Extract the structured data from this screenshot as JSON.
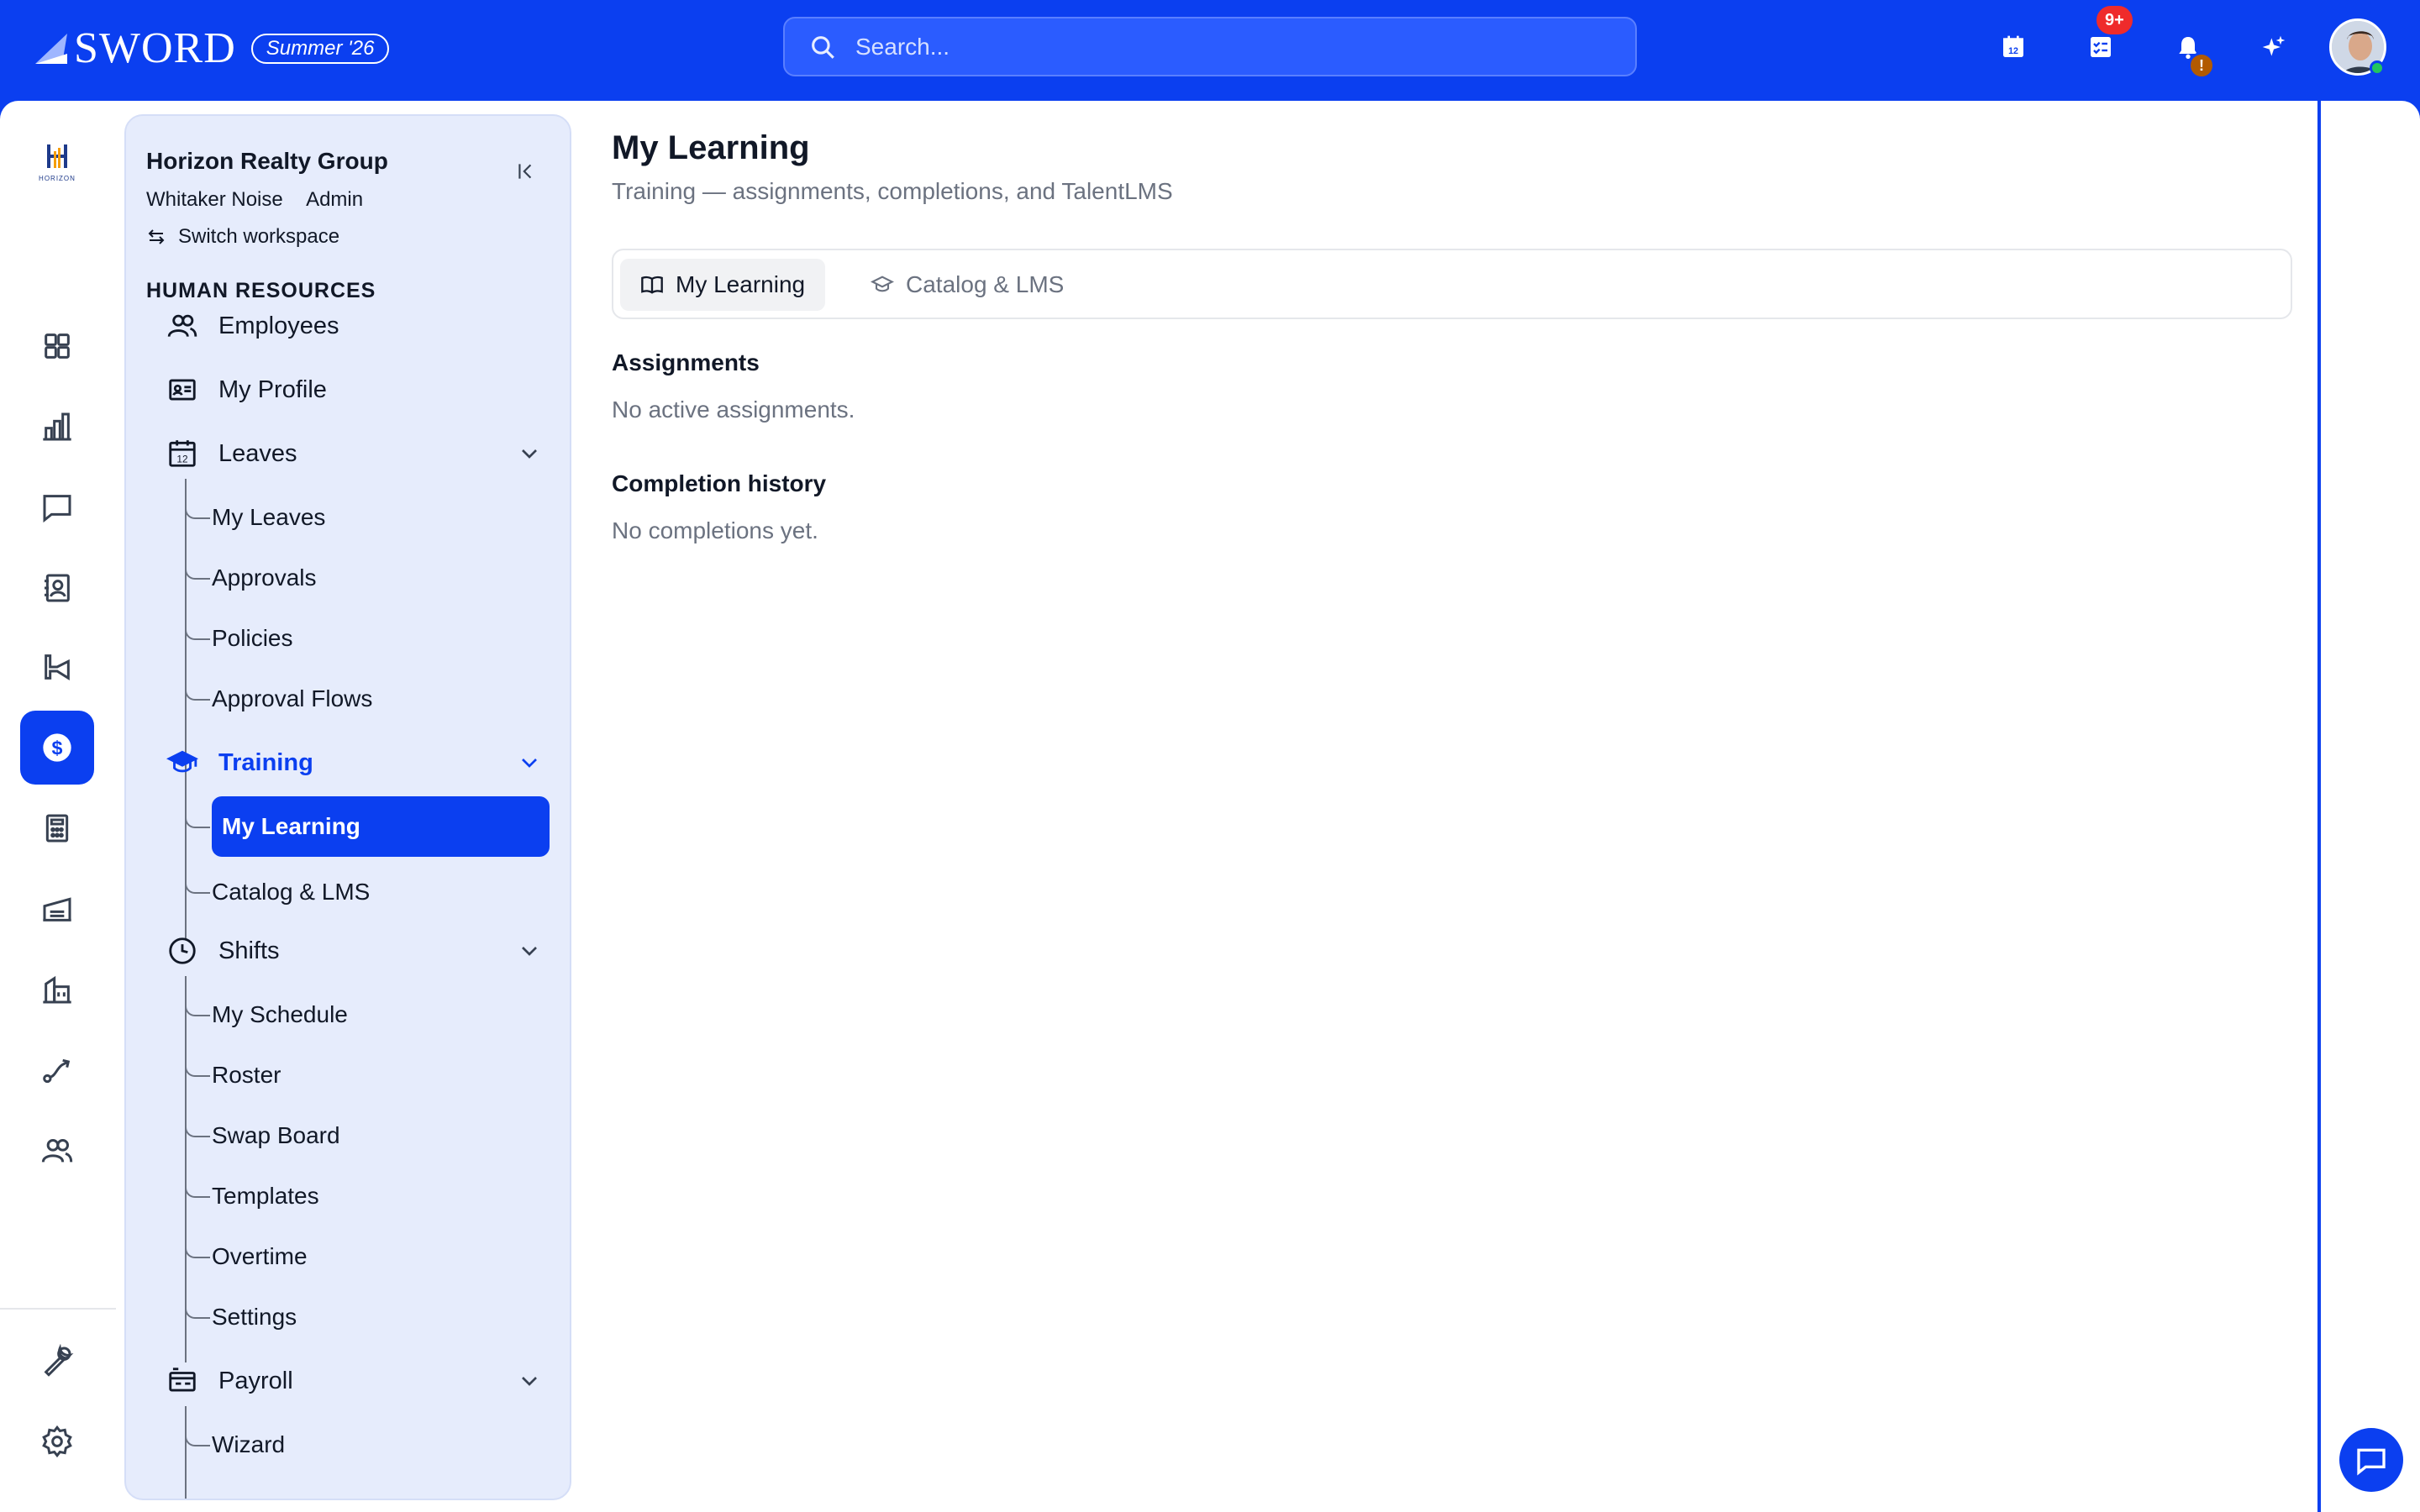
{
  "brand": {
    "name": "SWORD",
    "badge": "Summer '26"
  },
  "search": {
    "placeholder": "Search..."
  },
  "topbar": {
    "tasks_badge": "9+",
    "notifications_badge": "!",
    "icons": [
      "calendar-icon",
      "tasks-icon",
      "bell-icon",
      "sparkles-icon",
      "user-avatar"
    ]
  },
  "rail": {
    "logo_text": "HORIZON",
    "items": [
      "dashboard-icon",
      "chart-icon",
      "chat-icon",
      "contacts-icon",
      "megaphone-icon",
      "dollar-icon",
      "calculator-icon",
      "warehouse-icon",
      "building-icon",
      "route-icon",
      "users-icon",
      "wrench-icon",
      "settings-icon"
    ],
    "active": "dollar-icon"
  },
  "sidebar": {
    "org_name": "Horizon Realty Group",
    "user_name": "Whitaker Noise",
    "user_role": "Admin",
    "switch_label": "Switch workspace",
    "section_title": "HUMAN RESOURCES",
    "items": {
      "employees": "Employees",
      "my_profile": "My Profile",
      "leaves": "Leaves",
      "training": "Training",
      "shifts": "Shifts",
      "payroll": "Payroll"
    },
    "leaves_sub": [
      "My Leaves",
      "Approvals",
      "Policies",
      "Approval Flows"
    ],
    "training_sub": [
      "My Learning",
      "Catalog & LMS"
    ],
    "shifts_sub": [
      "My Schedule",
      "Roster",
      "Swap Board",
      "Templates",
      "Overtime",
      "Settings"
    ],
    "payroll_sub": [
      "Wizard"
    ],
    "leaves_calendar_day": "12"
  },
  "main": {
    "title": "My Learning",
    "subtitle": "Training — assignments, completions, and TalentLMS",
    "tabs": [
      "My Learning",
      "Catalog & LMS"
    ],
    "assignments_heading": "Assignments",
    "assignments_empty": "No active assignments.",
    "history_heading": "Completion history",
    "history_empty": "No completions yet."
  },
  "colors": {
    "primary": "#0b3ff0",
    "sidebar_bg": "#e6ecfc",
    "muted_text": "#6b7280",
    "badge_red": "#ef2b2b",
    "status_green": "#22c55e"
  }
}
